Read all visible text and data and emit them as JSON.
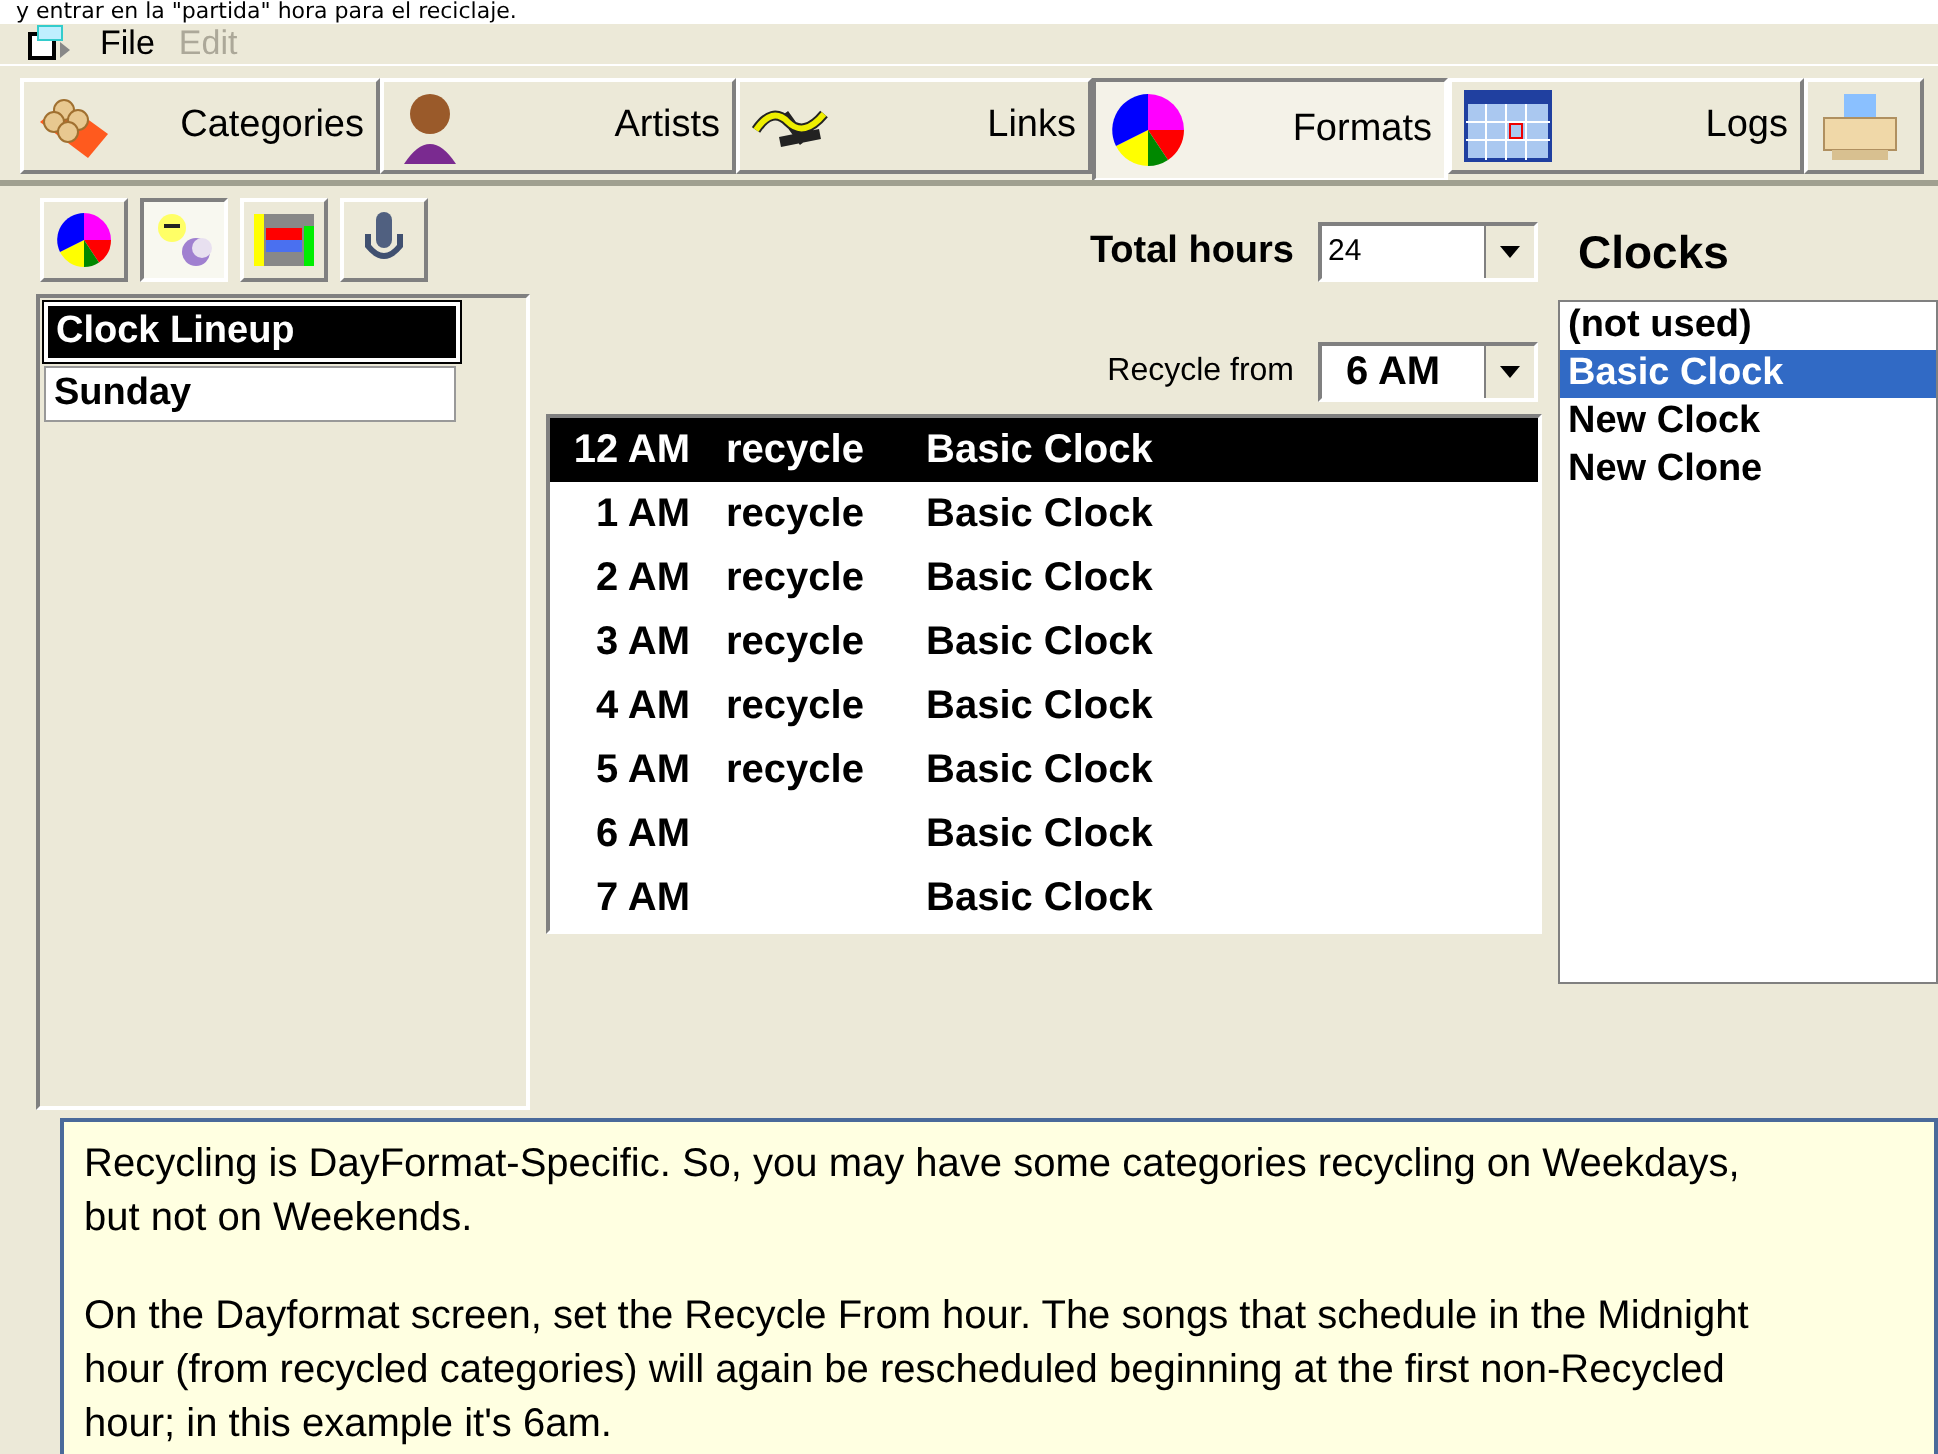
{
  "caption_fragment": "y entrar en la \"partida\" hora para el reciclaje.",
  "menu": [
    {
      "label": "File",
      "disabled": false
    },
    {
      "label": "Edit",
      "disabled": true
    }
  ],
  "tabs": [
    {
      "label": "Categories",
      "kind": "crate",
      "selected": false
    },
    {
      "label": "Artists",
      "kind": "person",
      "selected": false
    },
    {
      "label": "Links",
      "kind": "squiggle",
      "selected": false
    },
    {
      "label": "Formats",
      "kind": "pie",
      "selected": true
    },
    {
      "label": "Logs",
      "kind": "calendar",
      "selected": false
    },
    {
      "kind": "printer",
      "selected": false
    }
  ],
  "tools": [
    {
      "kind": "pie",
      "selected": false
    },
    {
      "kind": "sunmoon",
      "selected": true
    },
    {
      "kind": "bars",
      "selected": false
    },
    {
      "kind": "microphone",
      "selected": false
    }
  ],
  "lineup": [
    {
      "label": "Clock Lineup",
      "selected": true
    },
    {
      "label": "Sunday",
      "selected": false
    }
  ],
  "total_hours": {
    "label": "Total hours",
    "value": "24"
  },
  "recycle_from": {
    "label": "Recycle from",
    "value": "6 AM"
  },
  "hours": [
    {
      "hour": "12 AM",
      "recycle": "recycle",
      "clock": "Basic Clock",
      "selected": true
    },
    {
      "hour": "1 AM",
      "recycle": "recycle",
      "clock": "Basic Clock",
      "selected": false
    },
    {
      "hour": "2 AM",
      "recycle": "recycle",
      "clock": "Basic Clock",
      "selected": false
    },
    {
      "hour": "3 AM",
      "recycle": "recycle",
      "clock": "Basic Clock",
      "selected": false
    },
    {
      "hour": "4 AM",
      "recycle": "recycle",
      "clock": "Basic Clock",
      "selected": false
    },
    {
      "hour": "5 AM",
      "recycle": "recycle",
      "clock": "Basic Clock",
      "selected": false
    },
    {
      "hour": "6 AM",
      "clock": "Basic Clock",
      "selected": false
    },
    {
      "hour": "7 AM",
      "clock": "Basic Clock",
      "selected": false
    }
  ],
  "clocks": {
    "title": "Clocks",
    "items": [
      {
        "label": "(not used)",
        "selected": false
      },
      {
        "label": "Basic Clock",
        "selected": true
      },
      {
        "label": "New Clock",
        "selected": false
      },
      {
        "label": "New Clone",
        "selected": false
      }
    ]
  },
  "tooltip": {
    "paragraphs": [
      "Recycling is DayFormat-Specific. So, you may have some categories recycling on Weekdays, but not on Weekends.",
      "On the Dayformat screen, set the Recycle From hour. The songs that schedule in the Midnight hour (from recycled categories) will again be rescheduled beginning at the first non-Recycled hour; in this example it's 6am."
    ]
  }
}
